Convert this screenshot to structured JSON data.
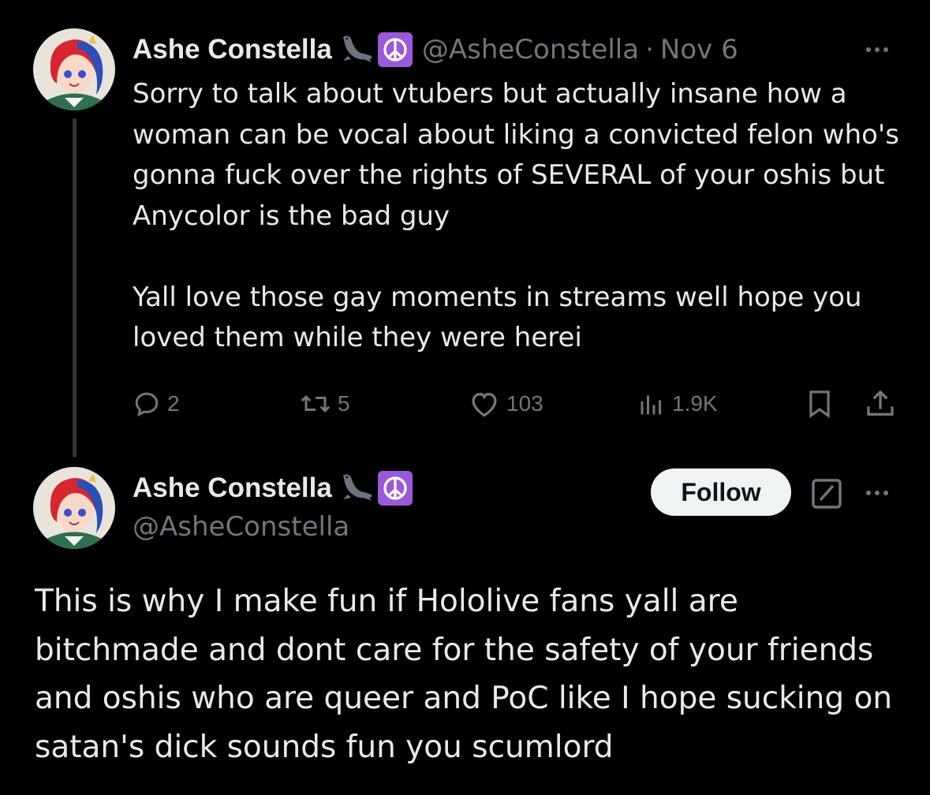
{
  "tweet1": {
    "author": {
      "display_name": "Ashe Constella",
      "emojis": [
        "seal-emoji",
        "peace-symbol-emoji"
      ],
      "handle": "@AsheConstella",
      "separator": "·",
      "date": "Nov 6"
    },
    "paragraphs": [
      "Sorry to talk about vtubers but actually insane how a woman can be vocal about liking a convicted felon who's gonna fuck over the rights of SEVERAL of your oshis but Anycolor is the bad guy",
      "Yall love those gay moments in streams well hope you loved them while they were herei"
    ],
    "actions": {
      "replies": "2",
      "reposts": "5",
      "likes": "103",
      "views": "1.9K"
    },
    "icons": {
      "reply": "reply-icon",
      "repost": "repost-icon",
      "like": "heart-icon",
      "views": "views-icon",
      "bookmark": "bookmark-icon",
      "share": "share-icon",
      "more": "more-icon"
    }
  },
  "tweet2": {
    "author": {
      "display_name": "Ashe Constella",
      "emojis": [
        "seal-emoji",
        "peace-symbol-emoji"
      ],
      "handle": "@AsheConstella"
    },
    "follow_label": "Follow",
    "text": "This is why I make fun if Hololive fans yall are bitchmade and dont care for the safety of your friends and oshis who are queer and PoC like I hope sucking on satan's dick sounds fun you scumlord",
    "icons": {
      "grok": "grok-icon",
      "more": "more-icon"
    }
  },
  "colors": {
    "background": "#000000",
    "text": "#e7e9ea",
    "muted": "#71767b",
    "thread_line": "#333639",
    "follow_bg": "#eff3f4",
    "peace_emoji_bg": "#9b59d9"
  }
}
